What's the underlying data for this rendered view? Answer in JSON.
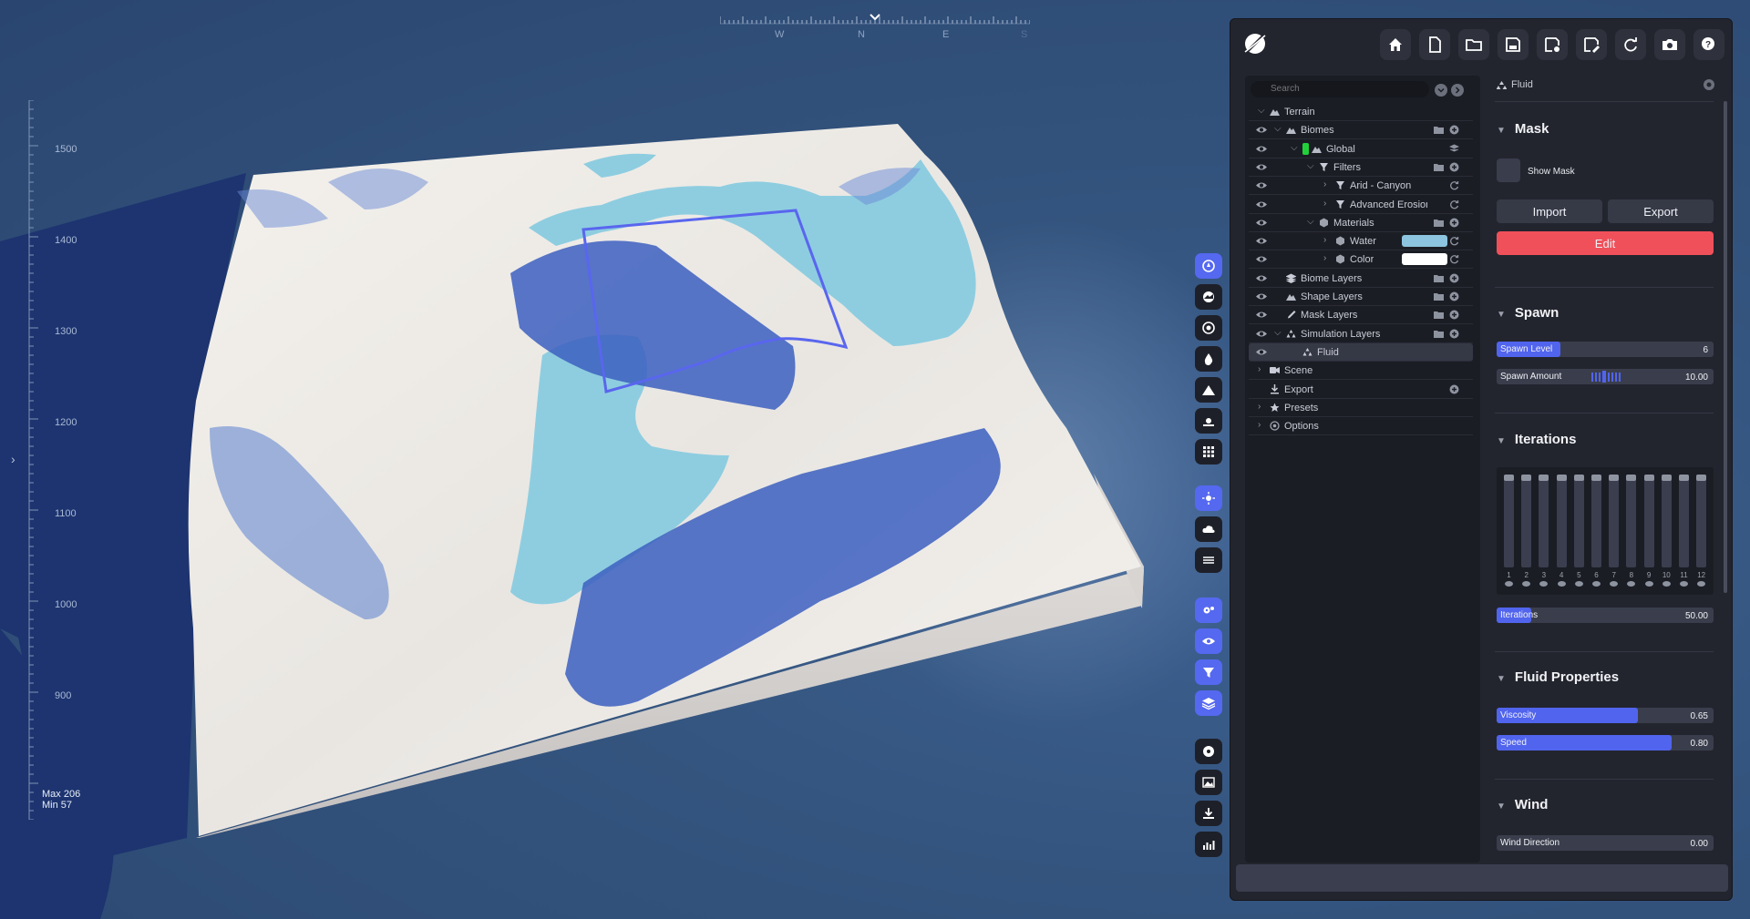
{
  "compass": {
    "letters": [
      "W",
      "N",
      "E",
      "S"
    ]
  },
  "ruler": {
    "labels": [
      "1500",
      "1400",
      "1300",
      "1200",
      "1100",
      "1000",
      "900"
    ],
    "max": "Max 206",
    "min": "Min 57"
  },
  "colors": {
    "accent": "#5164ee",
    "danger": "#f0505a",
    "panel": "#23252e",
    "water": "#8dc4e0",
    "biome_global": "#22d13a"
  },
  "toolbar_icons": [
    "globe-icon",
    "terrain-sphere-icon",
    "target-icon",
    "water-drop-icon",
    "mountain-icon",
    "sunset-icon",
    "grid-icon",
    "sun-icon",
    "cloud-icon",
    "fog-icon",
    "settings-gears-icon",
    "eye-icon",
    "filter-icon",
    "layers-icon",
    "disc-icon",
    "image-icon",
    "download-icon",
    "chart-icon"
  ],
  "topbar_icons": [
    "home-icon",
    "new-file-icon",
    "open-folder-icon",
    "save-icon",
    "save-settings-icon",
    "save-as-icon",
    "refresh-icon",
    "camera-icon",
    "help-icon"
  ],
  "tree": {
    "search_placeholder": "Search",
    "rows": [
      {
        "label": "Terrain"
      },
      {
        "label": "Biomes"
      },
      {
        "label": "Global"
      },
      {
        "label": "Filters"
      },
      {
        "label": "Arid - Canyon"
      },
      {
        "label": "Advanced Erosion - Sc"
      },
      {
        "label": "Materials"
      },
      {
        "label": "Water"
      },
      {
        "label": "Color"
      },
      {
        "label": "Biome Layers"
      },
      {
        "label": "Shape Layers"
      },
      {
        "label": "Mask Layers"
      },
      {
        "label": "Simulation Layers"
      },
      {
        "label": "Fluid"
      },
      {
        "label": "Scene"
      },
      {
        "label": "Export"
      },
      {
        "label": "Presets"
      },
      {
        "label": "Options"
      }
    ]
  },
  "props": {
    "header": "Fluid",
    "mask": {
      "title": "Mask",
      "show_mask": "Show Mask",
      "import": "Import",
      "export": "Export",
      "edit": "Edit"
    },
    "spawn": {
      "title": "Spawn",
      "level_label": "Spawn Level",
      "level_value": "6",
      "amount_label": "Spawn Amount",
      "amount_value": "10.00"
    },
    "iterations": {
      "title": "Iterations",
      "bar_labels": [
        "1",
        "2",
        "3",
        "4",
        "5",
        "6",
        "7",
        "8",
        "9",
        "10",
        "11",
        "12"
      ],
      "label": "Iterations",
      "value": "50.00"
    },
    "fluid": {
      "title": "Fluid Properties",
      "viscosity_label": "Viscosity",
      "viscosity_value": "0.65",
      "speed_label": "Speed",
      "speed_value": "0.80"
    },
    "wind": {
      "title": "Wind",
      "direction_label": "Wind Direction",
      "direction_value": "0.00"
    }
  }
}
